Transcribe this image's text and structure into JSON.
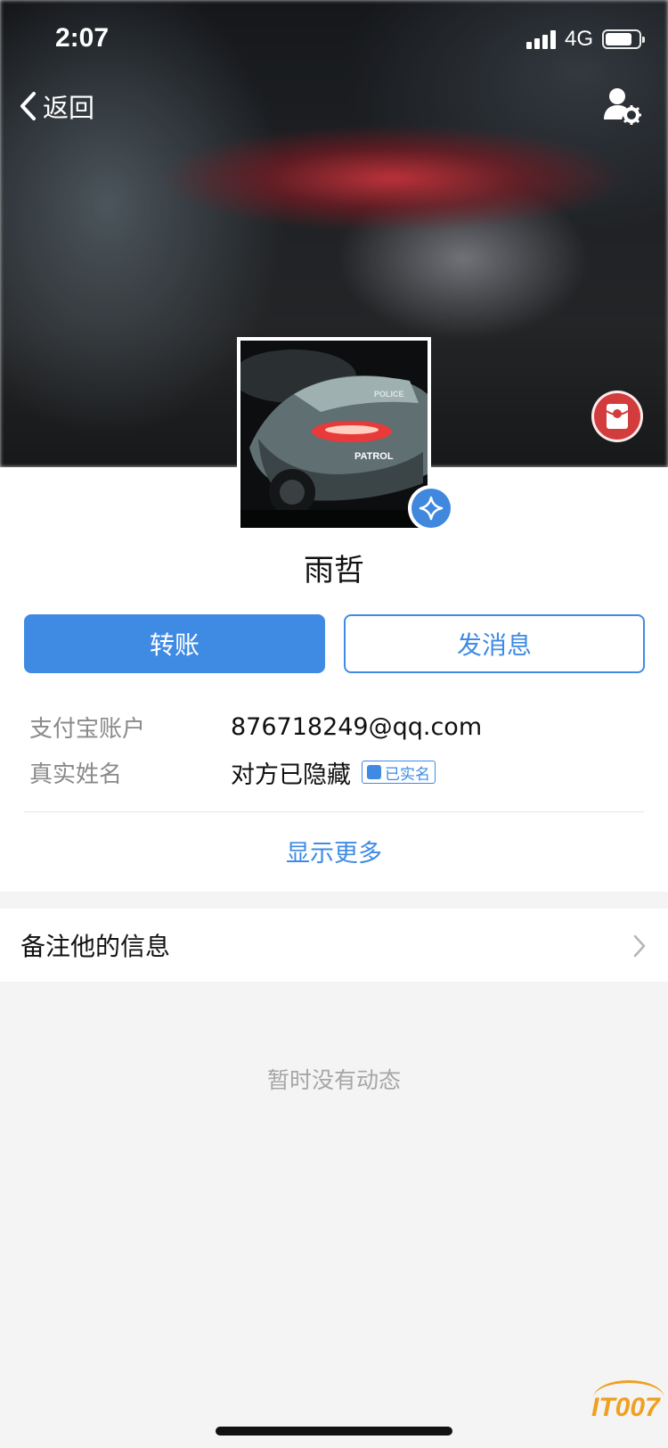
{
  "status_bar": {
    "time": "2:07",
    "network": "4G",
    "battery_level": 0.8
  },
  "nav": {
    "back_label": "返回",
    "settings_icon": "user-settings-icon"
  },
  "profile": {
    "name": "雨哲",
    "avatar_plate_text": "PATROL",
    "verified_icon": "verified-star-icon",
    "red_packet_icon": "red-packet-icon"
  },
  "actions": {
    "transfer_label": "转账",
    "message_label": "发消息"
  },
  "info": {
    "account_label": "支付宝账户",
    "account_value": "876718249@qq.com",
    "realname_label": "真实姓名",
    "realname_value": "对方已隐藏",
    "realname_tag": "已实名",
    "show_more": "显示更多"
  },
  "remark": {
    "label": "备注他的信息"
  },
  "feed": {
    "empty_text": "暂时没有动态"
  },
  "watermark": "IT007",
  "colors": {
    "accent": "#3f8be4",
    "red_packet": "#d23c3c",
    "background": "#f4f4f4"
  }
}
